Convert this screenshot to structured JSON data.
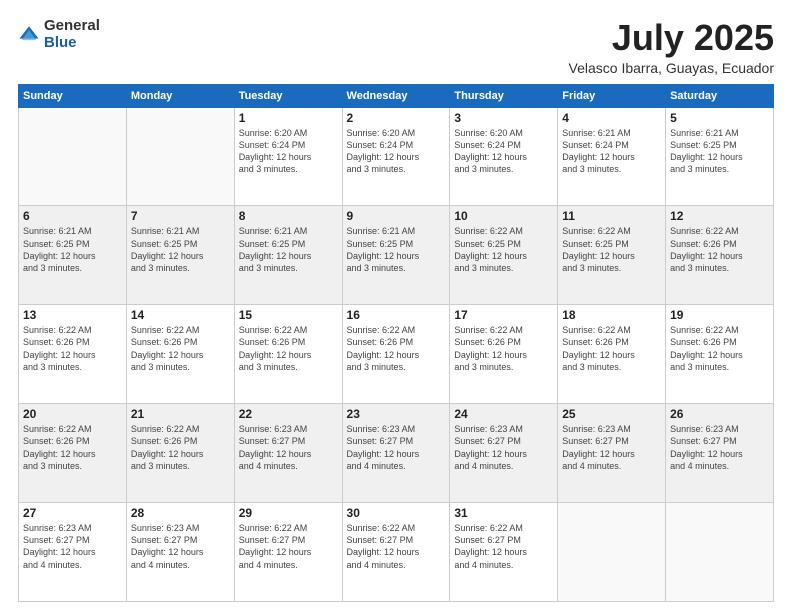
{
  "header": {
    "logo": {
      "line1": "General",
      "line2": "Blue"
    },
    "title": "July 2025",
    "location": "Velasco Ibarra, Guayas, Ecuador"
  },
  "days_of_week": [
    "Sunday",
    "Monday",
    "Tuesday",
    "Wednesday",
    "Thursday",
    "Friday",
    "Saturday"
  ],
  "weeks": [
    [
      {
        "day": "",
        "info": ""
      },
      {
        "day": "",
        "info": ""
      },
      {
        "day": "1",
        "info": "Sunrise: 6:20 AM\nSunset: 6:24 PM\nDaylight: 12 hours\nand 3 minutes."
      },
      {
        "day": "2",
        "info": "Sunrise: 6:20 AM\nSunset: 6:24 PM\nDaylight: 12 hours\nand 3 minutes."
      },
      {
        "day": "3",
        "info": "Sunrise: 6:20 AM\nSunset: 6:24 PM\nDaylight: 12 hours\nand 3 minutes."
      },
      {
        "day": "4",
        "info": "Sunrise: 6:21 AM\nSunset: 6:24 PM\nDaylight: 12 hours\nand 3 minutes."
      },
      {
        "day": "5",
        "info": "Sunrise: 6:21 AM\nSunset: 6:25 PM\nDaylight: 12 hours\nand 3 minutes."
      }
    ],
    [
      {
        "day": "6",
        "info": "Sunrise: 6:21 AM\nSunset: 6:25 PM\nDaylight: 12 hours\nand 3 minutes."
      },
      {
        "day": "7",
        "info": "Sunrise: 6:21 AM\nSunset: 6:25 PM\nDaylight: 12 hours\nand 3 minutes."
      },
      {
        "day": "8",
        "info": "Sunrise: 6:21 AM\nSunset: 6:25 PM\nDaylight: 12 hours\nand 3 minutes."
      },
      {
        "day": "9",
        "info": "Sunrise: 6:21 AM\nSunset: 6:25 PM\nDaylight: 12 hours\nand 3 minutes."
      },
      {
        "day": "10",
        "info": "Sunrise: 6:22 AM\nSunset: 6:25 PM\nDaylight: 12 hours\nand 3 minutes."
      },
      {
        "day": "11",
        "info": "Sunrise: 6:22 AM\nSunset: 6:25 PM\nDaylight: 12 hours\nand 3 minutes."
      },
      {
        "day": "12",
        "info": "Sunrise: 6:22 AM\nSunset: 6:26 PM\nDaylight: 12 hours\nand 3 minutes."
      }
    ],
    [
      {
        "day": "13",
        "info": "Sunrise: 6:22 AM\nSunset: 6:26 PM\nDaylight: 12 hours\nand 3 minutes."
      },
      {
        "day": "14",
        "info": "Sunrise: 6:22 AM\nSunset: 6:26 PM\nDaylight: 12 hours\nand 3 minutes."
      },
      {
        "day": "15",
        "info": "Sunrise: 6:22 AM\nSunset: 6:26 PM\nDaylight: 12 hours\nand 3 minutes."
      },
      {
        "day": "16",
        "info": "Sunrise: 6:22 AM\nSunset: 6:26 PM\nDaylight: 12 hours\nand 3 minutes."
      },
      {
        "day": "17",
        "info": "Sunrise: 6:22 AM\nSunset: 6:26 PM\nDaylight: 12 hours\nand 3 minutes."
      },
      {
        "day": "18",
        "info": "Sunrise: 6:22 AM\nSunset: 6:26 PM\nDaylight: 12 hours\nand 3 minutes."
      },
      {
        "day": "19",
        "info": "Sunrise: 6:22 AM\nSunset: 6:26 PM\nDaylight: 12 hours\nand 3 minutes."
      }
    ],
    [
      {
        "day": "20",
        "info": "Sunrise: 6:22 AM\nSunset: 6:26 PM\nDaylight: 12 hours\nand 3 minutes."
      },
      {
        "day": "21",
        "info": "Sunrise: 6:22 AM\nSunset: 6:26 PM\nDaylight: 12 hours\nand 3 minutes."
      },
      {
        "day": "22",
        "info": "Sunrise: 6:23 AM\nSunset: 6:27 PM\nDaylight: 12 hours\nand 4 minutes."
      },
      {
        "day": "23",
        "info": "Sunrise: 6:23 AM\nSunset: 6:27 PM\nDaylight: 12 hours\nand 4 minutes."
      },
      {
        "day": "24",
        "info": "Sunrise: 6:23 AM\nSunset: 6:27 PM\nDaylight: 12 hours\nand 4 minutes."
      },
      {
        "day": "25",
        "info": "Sunrise: 6:23 AM\nSunset: 6:27 PM\nDaylight: 12 hours\nand 4 minutes."
      },
      {
        "day": "26",
        "info": "Sunrise: 6:23 AM\nSunset: 6:27 PM\nDaylight: 12 hours\nand 4 minutes."
      }
    ],
    [
      {
        "day": "27",
        "info": "Sunrise: 6:23 AM\nSunset: 6:27 PM\nDaylight: 12 hours\nand 4 minutes."
      },
      {
        "day": "28",
        "info": "Sunrise: 6:23 AM\nSunset: 6:27 PM\nDaylight: 12 hours\nand 4 minutes."
      },
      {
        "day": "29",
        "info": "Sunrise: 6:22 AM\nSunset: 6:27 PM\nDaylight: 12 hours\nand 4 minutes."
      },
      {
        "day": "30",
        "info": "Sunrise: 6:22 AM\nSunset: 6:27 PM\nDaylight: 12 hours\nand 4 minutes."
      },
      {
        "day": "31",
        "info": "Sunrise: 6:22 AM\nSunset: 6:27 PM\nDaylight: 12 hours\nand 4 minutes."
      },
      {
        "day": "",
        "info": ""
      },
      {
        "day": "",
        "info": ""
      }
    ]
  ]
}
